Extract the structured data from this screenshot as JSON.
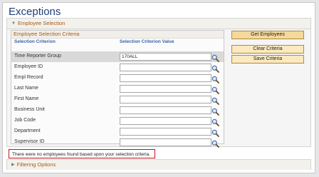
{
  "page": {
    "title": "Exceptions"
  },
  "employee_section": {
    "label": "Employee Selection",
    "criteria_title": "Employee Selection Criteria",
    "col_criterion": "Selection Criterion",
    "col_value": "Selection Criterion Value",
    "rows": [
      {
        "label": "Time Reporter Group",
        "value": "170ALL"
      },
      {
        "label": "Employee ID",
        "value": ""
      },
      {
        "label": "Empl Record",
        "value": ""
      },
      {
        "label": "Last Name",
        "value": ""
      },
      {
        "label": "First Name",
        "value": ""
      },
      {
        "label": "Business Unit",
        "value": ""
      },
      {
        "label": "Job Code",
        "value": ""
      },
      {
        "label": "Department",
        "value": ""
      },
      {
        "label": "Supervisor ID",
        "value": ""
      }
    ]
  },
  "buttons": {
    "get_employees": "Get Employees",
    "clear_criteria": "Clear Criteria",
    "save_criteria": "Save Criteria"
  },
  "message": "There were no employees found based upon your selection criteria.",
  "filtering_section": {
    "label": "Filtering Options"
  },
  "colors": {
    "title": "#1e3f7a",
    "section_label": "#a85a17",
    "column_header": "#3d62a5",
    "message_border": "#c0141c"
  },
  "icons": {
    "lookup": "magnifier-icon",
    "expanded": "triangle-down-icon",
    "collapsed": "triangle-right-icon"
  }
}
